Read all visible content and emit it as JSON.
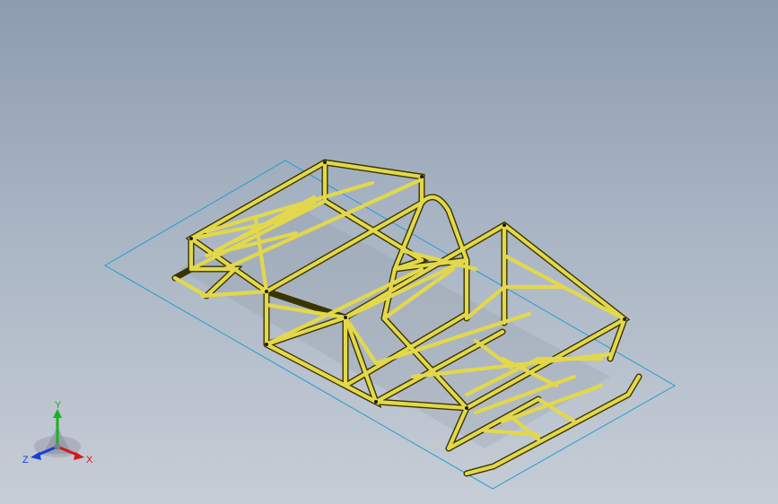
{
  "viewport": {
    "bg_top": "#8d9cb0",
    "bg_bottom": "#c6cdd6"
  },
  "model": {
    "tube_color": "#e3d84b",
    "tube_edge": "#3a3500",
    "sketch_plane_color": "#1f9fd0"
  },
  "triad": {
    "x_label": "X",
    "y_label": "Y",
    "z_label": "Z",
    "x_color": "#d11a1a",
    "y_color": "#19b21e",
    "z_color": "#1a3fd6"
  }
}
